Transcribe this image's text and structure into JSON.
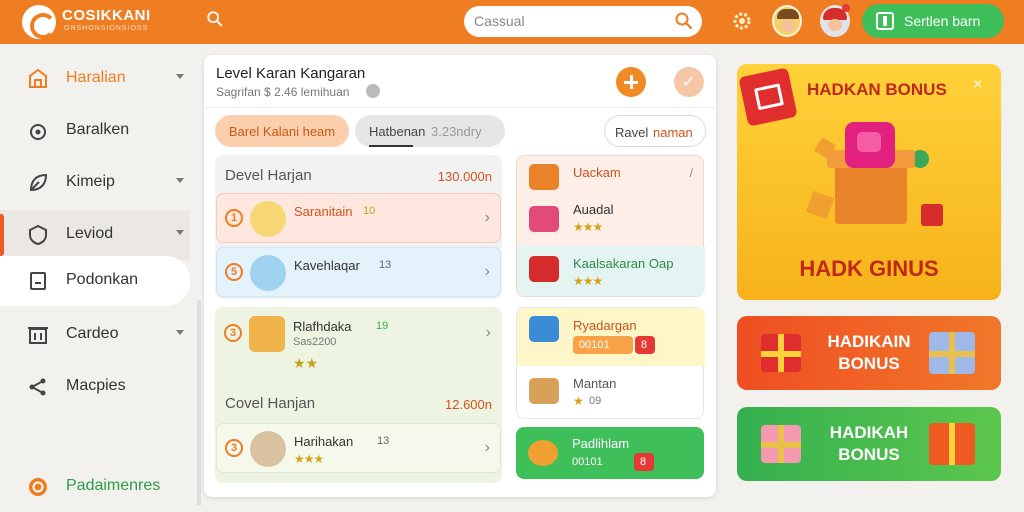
{
  "header": {
    "brand": "COSIKKANI",
    "brand_sub": "ONSHONSIONSIOSS",
    "search_placeholder": "Cassual",
    "action_button": "Sertlen barn"
  },
  "sidebar": {
    "items": [
      {
        "label": "Haralian"
      },
      {
        "label": "Baralken"
      },
      {
        "label": "Kimeip"
      },
      {
        "label": "Leviod"
      },
      {
        "label": "Podonkan"
      },
      {
        "label": "Cardeo"
      },
      {
        "label": "Macpies"
      },
      {
        "label": "Padaimenres"
      }
    ]
  },
  "panel": {
    "title": "Level Karan Kangaran",
    "subtitle": "Sagrifan $ 2.46 lemihuan",
    "tabs": [
      {
        "label": "Barel Kalani heam"
      },
      {
        "label": "Hatbenan",
        "extra": "3.23ndry"
      },
      {
        "label": "Ravel",
        "extra": "naman"
      }
    ]
  },
  "groups": [
    {
      "header": "Devel Harjan",
      "amount": "130.000n",
      "rows": [
        {
          "num": "1",
          "label": "Saranitain",
          "badge": "10"
        },
        {
          "num": "5",
          "label": "Kavehlaqar",
          "badge": "13"
        }
      ]
    },
    {
      "header": "Covel Hanjan",
      "amount": "12.600n",
      "rows": [
        {
          "num": "3",
          "label": "Rlafhdaka",
          "badge": "19",
          "sub": "Sas2200"
        },
        {
          "num": "3",
          "label": "Harihakan",
          "badge": "13"
        }
      ]
    }
  ],
  "cards": [
    {
      "label": "Uackam",
      "arrow": "/"
    },
    {
      "label": "Auadal",
      "stars": "★★★"
    },
    {
      "label": "Kaalsakaran Oap",
      "stars": "★★★"
    },
    {
      "label": "Ryadargan",
      "pill": "00101",
      "pill2": "8"
    },
    {
      "label": "Mantan",
      "stars": "★",
      "extra": "09"
    },
    {
      "label": "Padlihlam",
      "pill": "00101",
      "pill2": "8"
    }
  ],
  "promos": {
    "main_title": "HADKAN BONUS",
    "main_big": "HADK GINUS",
    "close": "×",
    "red_text": "HADIKAIN BONUS",
    "green_text": "HADIKAH BONUS"
  },
  "colors": {
    "accent": "#ef7d22",
    "green": "#3fbf5a",
    "red": "#e02d2d"
  }
}
